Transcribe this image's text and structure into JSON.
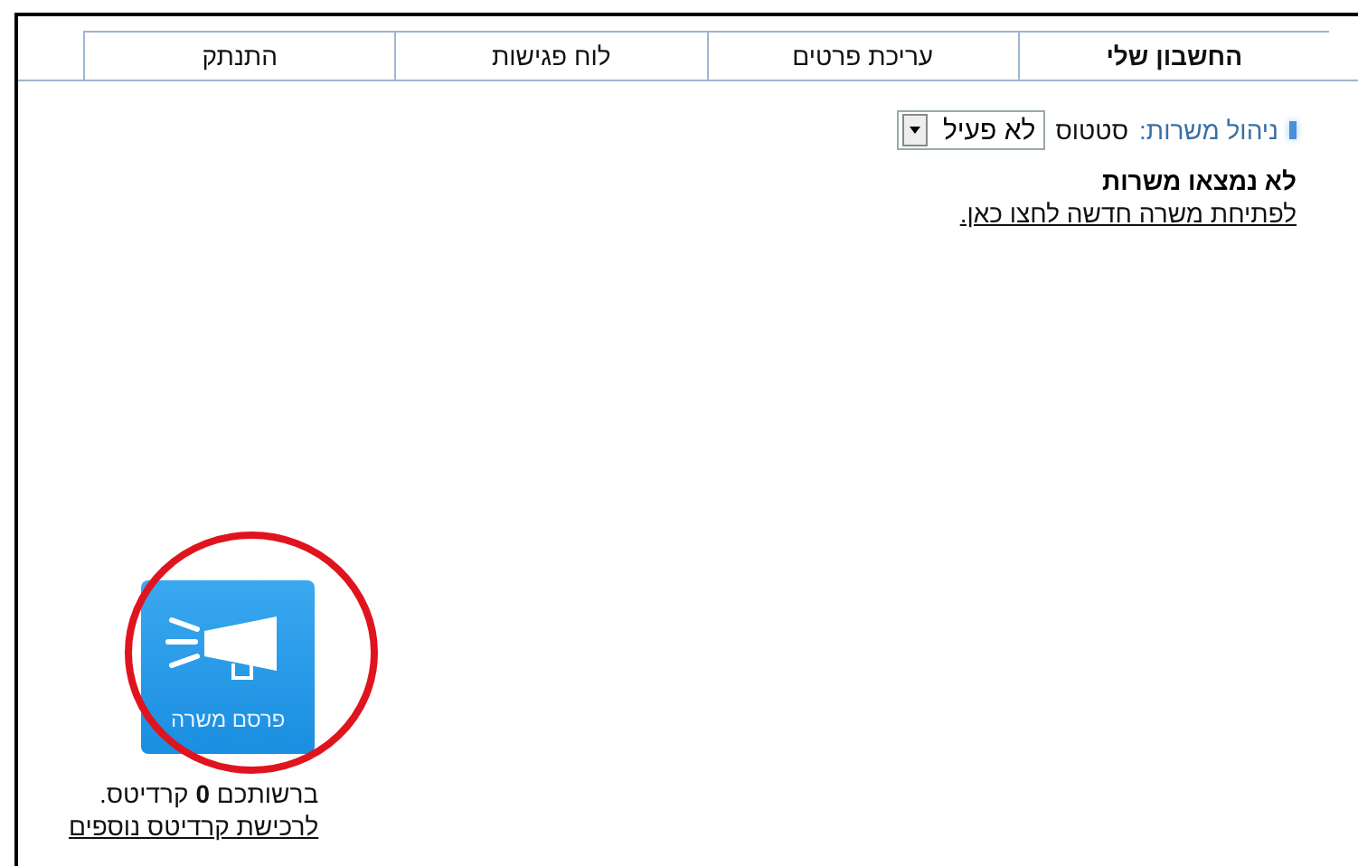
{
  "tabs": [
    {
      "label": "החשבון שלי",
      "selected": true
    },
    {
      "label": "עריכת פרטים",
      "selected": false
    },
    {
      "label": "לוח פגישות",
      "selected": false
    },
    {
      "label": "התנתק",
      "selected": false
    }
  ],
  "jobs": {
    "section_label": "ניהול משרות:",
    "status_label": "סטטוס",
    "status_value": "לא פעיל",
    "empty_title": "לא נמצאו משרות",
    "new_job_link": "לפתיחת משרה חדשה לחצו כאן."
  },
  "publish": {
    "button_label": "פרסם משרה",
    "credits_text": "ברשותכם **0** קרדיטס.",
    "buy_link": "לרכישת קרדיטס נוספים"
  }
}
